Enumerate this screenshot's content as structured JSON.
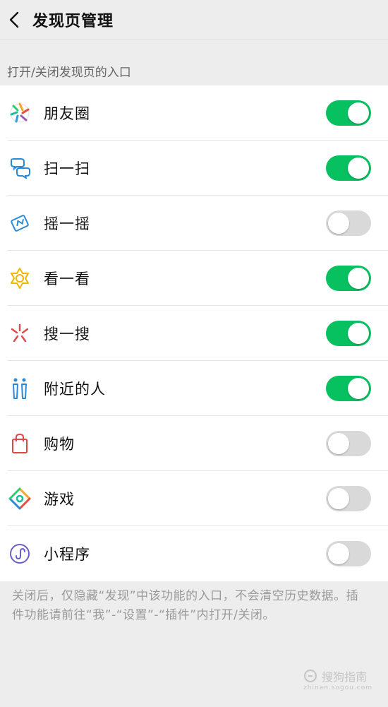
{
  "header": {
    "title": "发现页管理"
  },
  "section_hint": "打开/关闭发现页的入口",
  "items": [
    {
      "label": "朋友圈",
      "icon": "moments-icon",
      "on": true
    },
    {
      "label": "扫一扫",
      "icon": "scan-icon",
      "on": true
    },
    {
      "label": "摇一摇",
      "icon": "shake-icon",
      "on": false
    },
    {
      "label": "看一看",
      "icon": "top-stories-icon",
      "on": true
    },
    {
      "label": "搜一搜",
      "icon": "search-icon",
      "on": true
    },
    {
      "label": "附近的人",
      "icon": "people-nearby-icon",
      "on": true
    },
    {
      "label": "购物",
      "icon": "shopping-bag-icon",
      "on": false
    },
    {
      "label": "游戏",
      "icon": "games-icon",
      "on": false
    },
    {
      "label": "小程序",
      "icon": "mini-programs-icon",
      "on": false
    }
  ],
  "footer_note": "关闭后，仅隐藏“发现”中该功能的入口，不会清空历史数据。插件功能请前往“我”-“设置”-“插件”内打开/关闭。",
  "watermark": {
    "text": "搜狗指南",
    "sub": "zhinan.sogou.com"
  },
  "colors": {
    "toggle_on": "#07c160",
    "toggle_off": "#d9d9d9",
    "background": "#ededed"
  }
}
